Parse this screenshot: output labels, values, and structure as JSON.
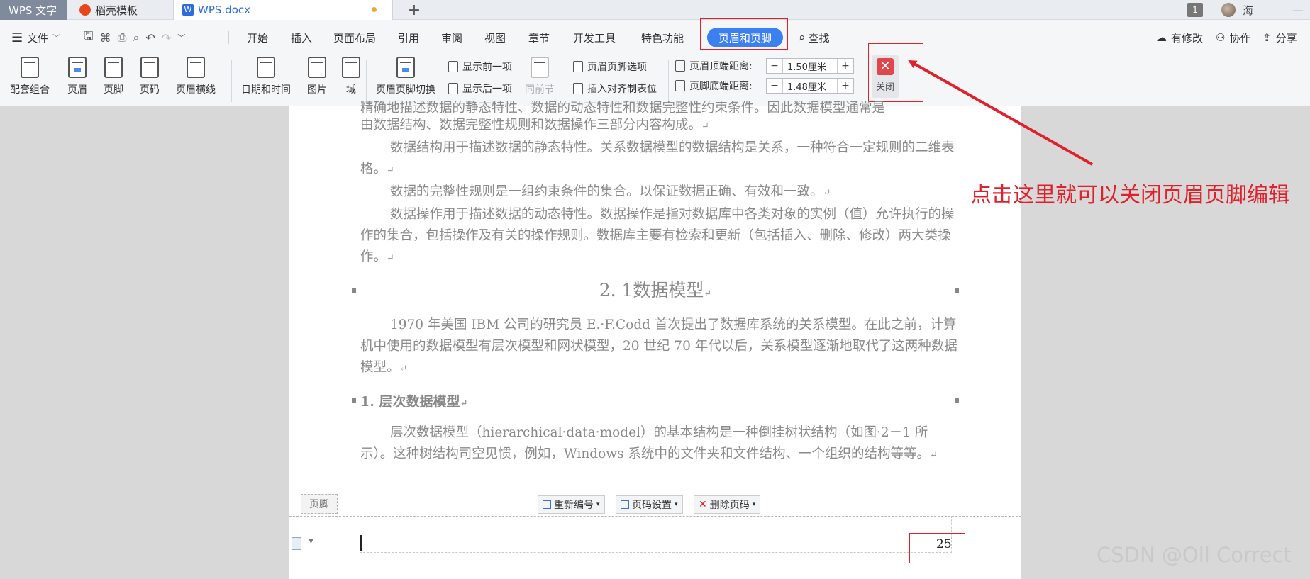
{
  "tabs": {
    "wps": "WPS 文字",
    "daoke": "稻壳模板",
    "doc": "WPS.docx",
    "new_tab": "+"
  },
  "titlebar_right": {
    "page_count": "1",
    "user": "海",
    "minimize": "—"
  },
  "menubar": {
    "file": "文件",
    "items": [
      "开始",
      "插入",
      "页面布局",
      "引用",
      "审阅",
      "视图",
      "章节",
      "开发工具",
      "特色功能",
      "页眉和页脚"
    ],
    "search": "查找",
    "right": [
      "有修改",
      "协作",
      "分享"
    ]
  },
  "ribbon": {
    "big_buttons": [
      "配套组合",
      "页眉",
      "页脚",
      "页码",
      "页眉横线",
      "日期和时间",
      "图片",
      "域",
      "页眉页脚切换"
    ],
    "show_prev": "显示前一项",
    "show_next": "显示后一项",
    "same_as_prev": "同前节",
    "hf_options": "页眉页脚选项",
    "insert_align_tab": "插入对齐制表位",
    "header_top_label": "页眉顶端距离:",
    "header_top_value": "1.50厘米",
    "footer_bottom_label": "页脚底端距离:",
    "footer_bottom_value": "1.48厘米",
    "minus": "−",
    "plus": "+",
    "close_label": "关闭"
  },
  "document": {
    "line0": "精确地描述数据的静态特性、数据的动态特性和数据完整性约束条件。因此数据模型通常是",
    "p1": "由数据结构、数据完整性规则和数据操作三部分内容构成。",
    "p2": "数据结构用于描述数据的静态特性。关系数据模型的数据结构是关系，一种符合一定规则的二维表格。",
    "p3": "数据的完整性规则是一组约束条件的集合。以保证数据正确、有效和一致。",
    "p4": "数据操作用于描述数据的动态特性。数据操作是指对数据库中各类对象的实例（值）允许执行的操作的集合，包括操作及有关的操作规则。数据库主要有检索和更新（包括插入、删除、修改）两大类操作。",
    "heading": "2. 1数据模型",
    "p5": "1970 年美国 IBM 公司的研究员 E.·F.Codd 首次提出了数据库系统的关系模型。在此之前，计算机中使用的数据模型有层次模型和网状模型，20 世纪 70 年代以后，关系模型逐渐地取代了这两种数据模型。",
    "subheading": "1. 层次数据模型",
    "p6": "层次数据模型（hierarchical·data·model）的基本结构是一种倒挂树状结构（如图·2－1 所示）。这种树结构司空见惯，例如，Windows 系统中的文件夹和文件结构、一个组织的结构等等。",
    "para_mark": "↵"
  },
  "footer": {
    "label": "页脚",
    "renumber": "重新编号",
    "page_settings": "页码设置",
    "delete_page_num": "删除页码",
    "page_number": "25"
  },
  "annotation": {
    "text": "点击这里就可以关闭页眉页脚编辑"
  },
  "watermark": "CSDN @Oll Correct",
  "colors": {
    "accent": "#3b7ff1",
    "annotation_red": "#e0202a",
    "close_red": "#e0474c"
  }
}
